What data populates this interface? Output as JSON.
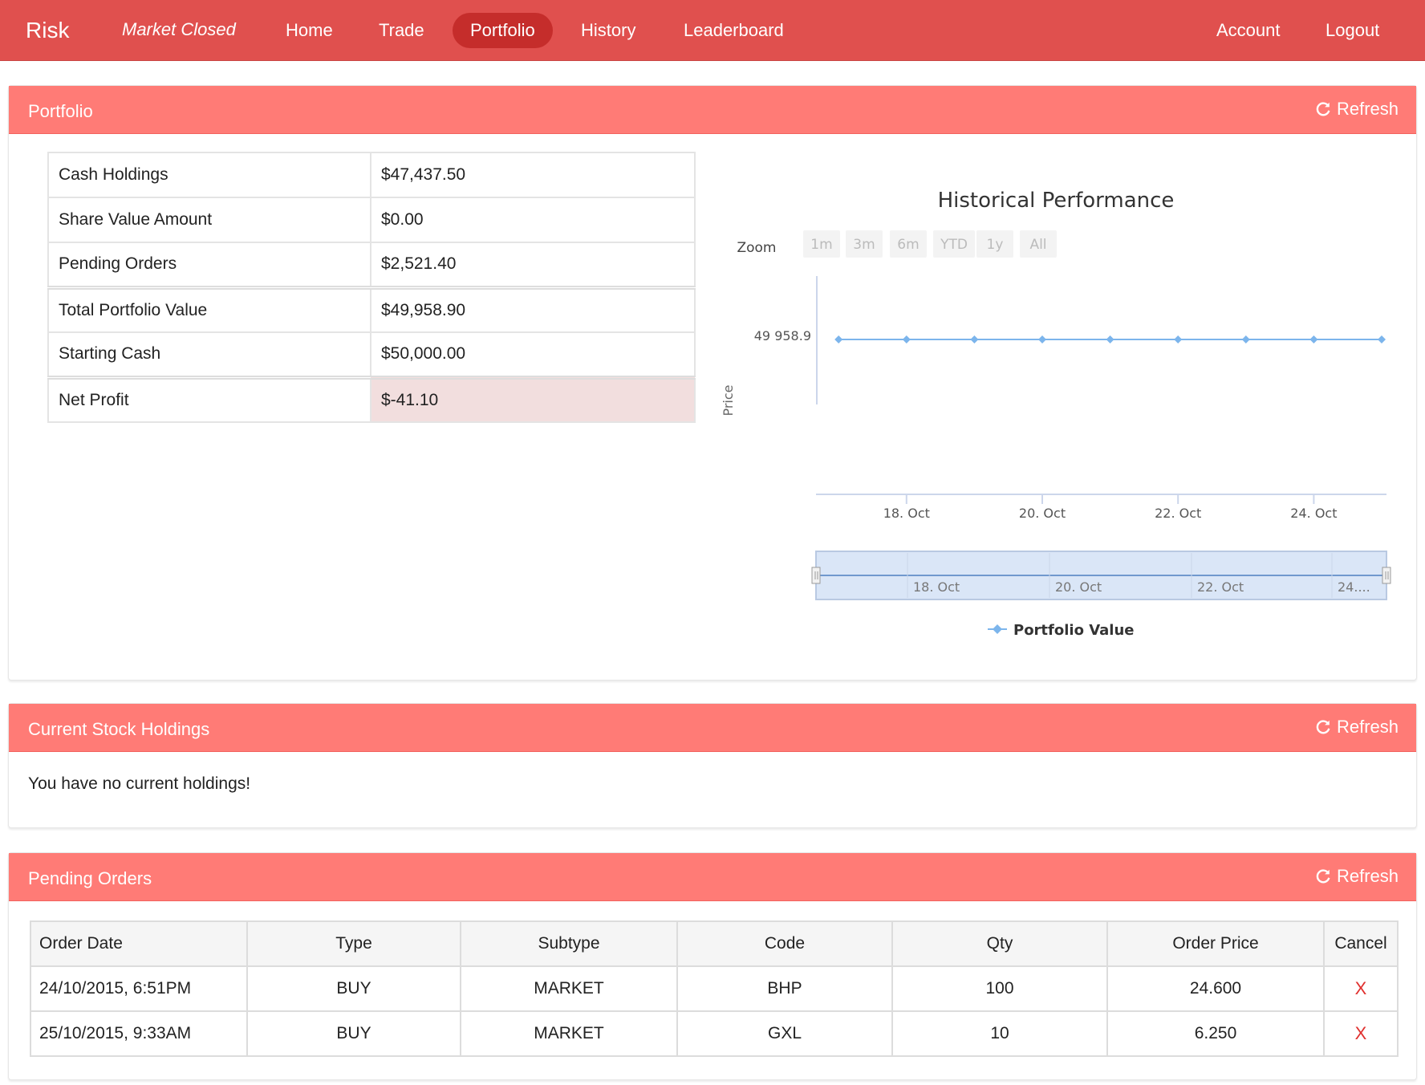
{
  "nav": {
    "brand": "Risk",
    "market_status": "Market Closed",
    "links": [
      "Home",
      "Trade",
      "Portfolio",
      "History",
      "Leaderboard"
    ],
    "active": "Portfolio",
    "account": "Account",
    "logout": "Logout"
  },
  "portfolio": {
    "title": "Portfolio",
    "refresh_label": "Refresh",
    "rows": [
      {
        "label": "Cash Holdings",
        "value": "$47,437.50"
      },
      {
        "label": "Share Value Amount",
        "value": "$0.00"
      },
      {
        "label": "Pending Orders",
        "value": "$2,521.40"
      },
      {
        "label": "Total Portfolio Value",
        "value": "$49,958.90"
      },
      {
        "label": "Starting Cash",
        "value": "$50,000.00"
      },
      {
        "label": "Net Profit",
        "value": "$-41.10"
      }
    ]
  },
  "chart": {
    "zoom_label": "Zoom",
    "zoom_buttons": [
      "1m",
      "3m",
      "6m",
      "YTD",
      "1y",
      "All"
    ],
    "navigator_labels": [
      "18. Oct",
      "20. Oct",
      "22. Oct",
      "24...."
    ]
  },
  "chart_data": {
    "type": "line",
    "title": "Historical Performance",
    "ylabel": "Price",
    "xlabel": "",
    "y_tick_labels": [
      "49 958.9"
    ],
    "x_tick_labels": [
      "18. Oct",
      "20. Oct",
      "22. Oct",
      "24. Oct"
    ],
    "series": [
      {
        "name": "Portfolio Value",
        "color": "#7cb5ec",
        "x": [
          "2015-10-17",
          "2015-10-18",
          "2015-10-19",
          "2015-10-20",
          "2015-10-21",
          "2015-10-22",
          "2015-10-23",
          "2015-10-24",
          "2015-10-25"
        ],
        "values": [
          49958.9,
          49958.9,
          49958.9,
          49958.9,
          49958.9,
          49958.9,
          49958.9,
          49958.9,
          49958.9
        ]
      }
    ],
    "xlim": [
      "2015-10-16T16:00",
      "2015-10-25"
    ],
    "legend": "bottom-center",
    "grid": false
  },
  "holdings": {
    "title": "Current Stock Holdings",
    "refresh_label": "Refresh",
    "empty_message": "You have no current holdings!"
  },
  "orders": {
    "title": "Pending Orders",
    "refresh_label": "Refresh",
    "columns": [
      "Order Date",
      "Type",
      "Subtype",
      "Code",
      "Qty",
      "Order Price",
      "Cancel"
    ],
    "rows": [
      {
        "date": "24/10/2015, 6:51PM",
        "type": "BUY",
        "subtype": "MARKET",
        "code": "BHP",
        "qty": "100",
        "price": "24.600",
        "cancel": "X"
      },
      {
        "date": "25/10/2015, 9:33AM",
        "type": "BUY",
        "subtype": "MARKET",
        "code": "GXL",
        "qty": "10",
        "price": "6.250",
        "cancel": "X"
      }
    ]
  }
}
